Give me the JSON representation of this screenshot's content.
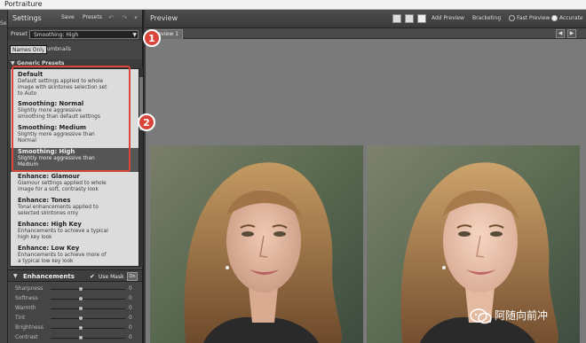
{
  "window": {
    "title": "Portraiture"
  },
  "left_strip": {
    "label": "Se"
  },
  "settings": {
    "title": "Settings",
    "save": "Save",
    "presets": "Presets",
    "preset_label": "Preset",
    "preset_value": "Smoothing: High",
    "view_names_only": "Names Only",
    "view_thumbnails": "Thumbnails",
    "group_title": "Generic Presets",
    "items": [
      {
        "name": "Default",
        "desc": "Default settings applied to whole image with skintones selection set to Auto"
      },
      {
        "name": "Smoothing: Normal",
        "desc": "Slightly more aggressive smoothing than default settings"
      },
      {
        "name": "Smoothing: Medium",
        "desc": "Slightly more aggressive than Normal"
      },
      {
        "name": "Smoothing: High",
        "desc": "Slightly more aggressive than Medium"
      },
      {
        "name": "Enhance: Glamour",
        "desc": "Glamour settings applied to whole image for a soft, contrasty look"
      },
      {
        "name": "Enhance: Tones",
        "desc": "Tonal enhancements applied to selected skintones only"
      },
      {
        "name": "Enhance: High Key",
        "desc": "Enhancements to achieve a typical high key look"
      },
      {
        "name": "Enhance: Low Key",
        "desc": "Enhancements to achieve more of a typical low key look"
      }
    ]
  },
  "enhancements": {
    "title": "Enhancements",
    "use_mask": "Use Mask",
    "on": "On",
    "sliders": [
      {
        "label": "Sharpness",
        "value": "0"
      },
      {
        "label": "Softness",
        "value": "0"
      },
      {
        "label": "Warmth",
        "value": "0"
      },
      {
        "label": "Tint",
        "value": "0"
      },
      {
        "label": "Brightness",
        "value": "0"
      },
      {
        "label": "Contrast",
        "value": "0"
      }
    ]
  },
  "preview": {
    "title": "Preview",
    "add_preview": "Add Preview",
    "bracketing": "Bracketing",
    "fast_preview": "Fast Preview",
    "accurate": "Accurate",
    "tab": "Preview 1"
  },
  "annotations": {
    "badge1": "1",
    "badge2": "2"
  },
  "watermark": {
    "text": "阿随向前冲"
  },
  "colors": {
    "annotation": "#d9453a",
    "panel": "#454545",
    "list_bg": "#dcdcdc"
  },
  "icons": [
    "wechat-icon",
    "undo-icon",
    "redo-icon",
    "menu-icon",
    "layout-single-icon",
    "layout-split-icon",
    "layout-dual-icon",
    "prev-icon",
    "next-icon",
    "checkbox-icon"
  ]
}
